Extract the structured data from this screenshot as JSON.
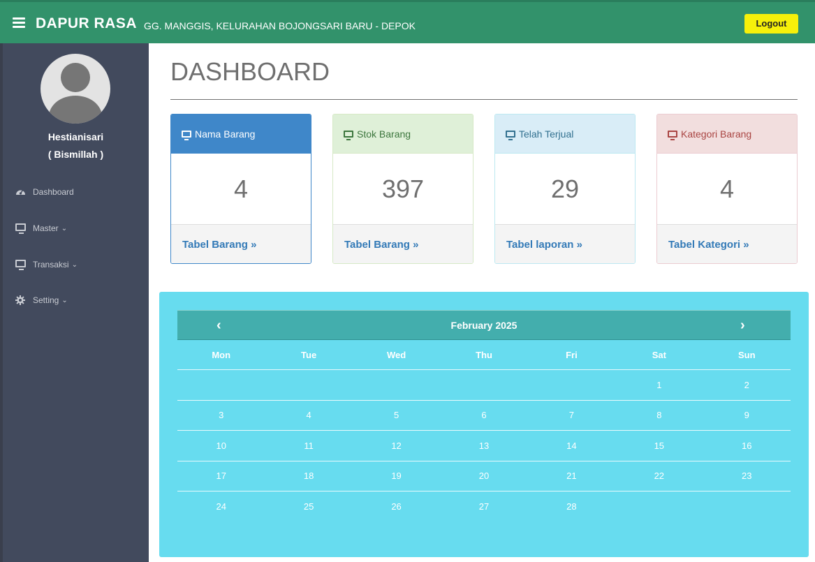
{
  "header": {
    "brand": "DAPUR RASA",
    "address": "GG. MANGGIS, KELURAHAN BOJONGSARI BARU - DEPOK",
    "logout_label": "Logout",
    "colors": {
      "bar": "#32926b",
      "logout": "#f6f00a"
    }
  },
  "sidebar": {
    "user_name": "Hestianisari",
    "user_sub": "( Bismillah )",
    "items": [
      {
        "label": "Dashboard",
        "icon": "dashboard-icon"
      },
      {
        "label": "Master",
        "icon": "desktop-icon",
        "chevron": "⌄"
      },
      {
        "label": "Transaksi",
        "icon": "desktop-icon",
        "chevron": "⌄"
      },
      {
        "label": "Setting",
        "icon": "gear-icon",
        "chevron": "⌄"
      }
    ]
  },
  "page": {
    "title": "DASHBOARD"
  },
  "cards": [
    {
      "title": "Nama Barang",
      "value": "4",
      "link": "Tabel Barang »"
    },
    {
      "title": "Stok Barang",
      "value": "397",
      "link": "Tabel Barang »"
    },
    {
      "title": "Telah Terjual",
      "value": "29",
      "link": "Tabel laporan »"
    },
    {
      "title": "Kategori Barang",
      "value": "4",
      "link": "Tabel Kategori »"
    }
  ],
  "calendar": {
    "month_label": "February 2025",
    "prev": "‹",
    "next": "›",
    "weekdays": [
      "Mon",
      "Tue",
      "Wed",
      "Thu",
      "Fri",
      "Sat",
      "Sun"
    ],
    "weeks": [
      [
        "",
        "",
        "",
        "",
        "",
        "1",
        "2"
      ],
      [
        "3",
        "4",
        "5",
        "6",
        "7",
        "8",
        "9"
      ],
      [
        "10",
        "11",
        "12",
        "13",
        "14",
        "15",
        "16"
      ],
      [
        "17",
        "18",
        "19",
        "20",
        "21",
        "22",
        "23"
      ],
      [
        "24",
        "25",
        "26",
        "27",
        "28",
        "",
        ""
      ]
    ]
  }
}
